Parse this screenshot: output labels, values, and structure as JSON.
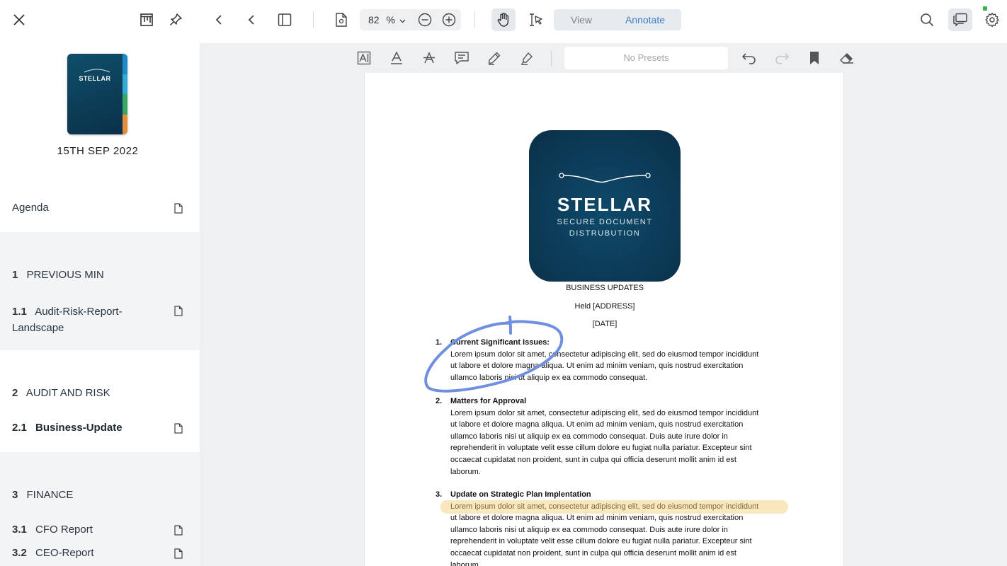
{
  "sidebar": {
    "cover_title": "STELLAR",
    "cover_tab_colors": [
      "#1e88c8",
      "#33aad6",
      "#3aa664",
      "#e48b3c"
    ],
    "date": "15TH SEP 2022",
    "agenda_label": "Agenda",
    "sections": [
      {
        "num": "1",
        "title": "PREVIOUS MIN",
        "items": [
          {
            "num": "1.1",
            "title_line1": "Audit-Risk-Report-",
            "title_line2": "Landscape"
          }
        ]
      },
      {
        "num": "2",
        "title": "AUDIT AND RISK",
        "items": [
          {
            "num": "2.1",
            "title": "Business-Update"
          }
        ]
      },
      {
        "num": "3",
        "title": "FINANCE",
        "items": [
          {
            "num": "3.1",
            "title": "CFO Report"
          },
          {
            "num": "3.2",
            "title": "CEO-Report"
          }
        ]
      }
    ]
  },
  "toolbar": {
    "zoom_value": "82",
    "zoom_unit": "%",
    "view_label": "View",
    "annotate_label": "Annotate",
    "accent_color": "#3d7fc6"
  },
  "annotation_toolbar": {
    "preset_placeholder": "No Presets"
  },
  "document": {
    "logo_title": "STELLAR",
    "logo_sub_line1": "SECURE DOCUMENT",
    "logo_sub_line2": "DISTRUBUTION",
    "heading": "BUSINESS UPDATES",
    "held": "Held [ADDRESS]",
    "date": "[DATE]",
    "sections": [
      {
        "num": "1.",
        "title": "Current Significant Issues:",
        "lines": [
          "Lorem ipsum dolor sit amet, consectetur adipiscing elit, sed do eiusmod tempor incididunt",
          "ut labore et dolore magna aliqua. Ut enim ad minim veniam, quis nostrud exercitation",
          "ullamco laboris nisi ut aliquip ex ea commodo consequat."
        ]
      },
      {
        "num": "2.",
        "title": "Matters for Approval",
        "lines": [
          "Lorem ipsum dolor sit amet, consectetur adipiscing elit, sed do eiusmod tempor incididunt",
          "ut labore et dolore magna aliqua. Ut enim ad minim veniam, quis nostrud exercitation",
          "ullamco laboris nisi ut aliquip ex ea commodo consequat. Duis aute irure dolor in",
          "reprehenderit in voluptate velit esse cillum dolore eu fugiat nulla pariatur. Excepteur sint",
          "occaecat cupidatat non proident, sunt in culpa qui officia deserunt mollit anim id est",
          "laborum."
        ]
      },
      {
        "num": "3.",
        "title": "Update on Strategic Plan Implentation",
        "lines": [
          "Lorem ipsum dolor sit amet, consectetur adipiscing elit, sed do eiusmod tempor incididunt",
          "ut labore et dolore magna aliqua. Ut enim ad minim veniam, quis nostrud exercitation",
          "ullamco laboris nisi ut aliquip ex ea commodo consequat. Duis aute irure dolor in",
          "reprehenderit in voluptate velit esse cillum dolore eu fugiat nulla pariatur. Excepteur sint",
          "occaecat cupidatat non proident, sunt in culpa qui officia deserunt mollit anim id est",
          "laborum."
        ]
      }
    ],
    "ink_color": "#6f8fe0",
    "highlight_color": "#f9e7bd"
  }
}
